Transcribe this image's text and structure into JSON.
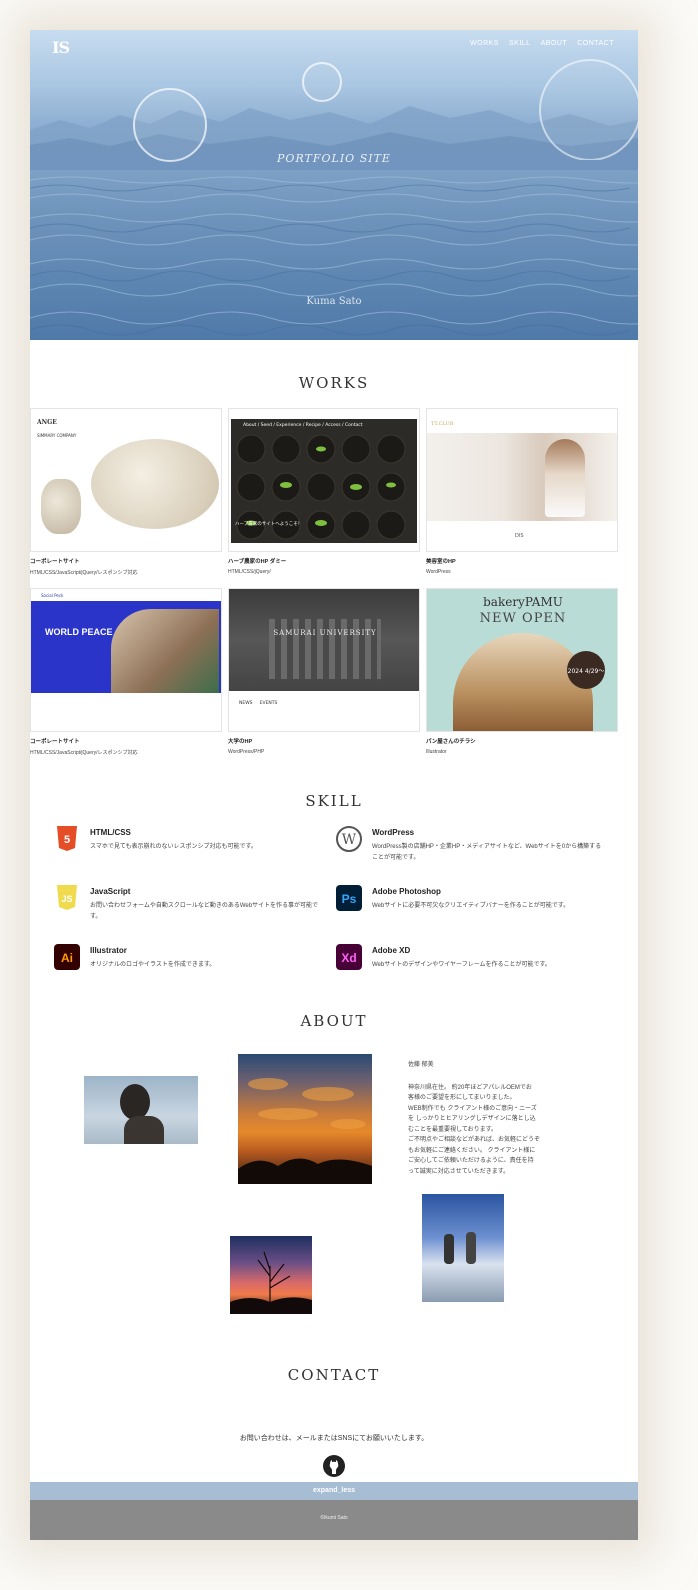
{
  "header": {
    "logo": "IS",
    "nav": [
      "WORKS",
      "SKILL",
      "ABOUT",
      "CONTACT"
    ],
    "hero_title": "PORTFOLIO SITE",
    "hero_sub": "Kuma Sato"
  },
  "works": {
    "title": "WORKS",
    "items": [
      {
        "title": "コーポレートサイト",
        "tech": "HTML/CSS/JavaScript/jQuery/レスポンシブ対応",
        "thumb_text": "ANGE",
        "thumb_sub": "SIMMARY COMPANY"
      },
      {
        "title": "ハーブ農家のHP ダミー",
        "tech": "HTML/CSS/jQuery/",
        "thumb_text": "About / Seed / Experience / Recipe / Access / Contact",
        "thumb_sub": "ハーブ農家のサイトへようこそ！"
      },
      {
        "title": "美容室のHP",
        "tech": "WordPress",
        "thumb_text": "TT.CLUB",
        "thumb_sub": "DIS"
      },
      {
        "title": "コーポレートサイト",
        "tech": "HTML/CSS/JavaScript/jQuery/レスポンシブ対応",
        "thumb_text": "WORLD PEACE",
        "thumb_sub": "Social Peck"
      },
      {
        "title": "大学のHP",
        "tech": "WordPress/PHP",
        "thumb_text": "SAMURAI UNIVERSITY",
        "thumb_sub": "NEWS     EVENTS"
      },
      {
        "title": "パン屋さんのチラシ",
        "tech": "Illustrator",
        "thumb_text": "bakeryPAMU",
        "thumb_sub": "NEW OPEN",
        "thumb_date": "2024 4/29〜"
      }
    ]
  },
  "skill": {
    "title": "SKILL",
    "items": [
      {
        "name": "HTML/CSS",
        "desc": "スマホで見ても表示崩れのないレスポンシブ対応も可能です。",
        "icon": "html5-icon",
        "badge": "5"
      },
      {
        "name": "WordPress",
        "desc": "WordPress製の店舗HP・企業HP・メディアサイトなど、Webサイトを0から構築することが可能です。",
        "icon": "wordpress-icon",
        "badge": "W"
      },
      {
        "name": "JavaScript",
        "desc": "お問い合わせフォームや自動スクロールなど動きのあるWebサイトを作る事が可能です。",
        "icon": "javascript-icon",
        "badge": "JS"
      },
      {
        "name": "Adobe Photoshop",
        "desc": "Webサイトに必要不可欠なクリエイティブバナーを作ることが可能です。",
        "icon": "photoshop-icon",
        "badge": "Ps"
      },
      {
        "name": "Illustrator",
        "desc": "オリジナルのロゴやイラストを作成できます。",
        "icon": "illustrator-icon",
        "badge": "Ai"
      },
      {
        "name": "Adobe XD",
        "desc": "Webサイトのデザインやワイヤーフレームを作ることが可能です。",
        "icon": "xd-icon",
        "badge": "Xd"
      }
    ]
  },
  "about": {
    "title": "ABOUT",
    "name": "佐藤 郁美",
    "lines": [
      "神奈川県在住。 約20年ほどアパレルOEMでお",
      "客様のご要望を形にしてまいりました。",
      "WEB制作でも クライアント様のご意向・ニーズ",
      "を しっかりとヒアリングしデザインに落とし込",
      "むことを最重要視しております。",
      "ご不明点やご相談などがあれば、お気軽にどうぞ",
      "もお気軽にご連絡ください。 クライアント様に",
      "ご安心してご依頼いただけるように、責任を持",
      "って誠実に対応させていただきます。"
    ]
  },
  "contact": {
    "title": "CONTACT",
    "text": "お問い合わせは、メールまたはSNSにてお願いいたします。",
    "icon": "github-icon",
    "expand_label": "expand_less",
    "footer": "©Ikumi Sato"
  },
  "colors": {
    "expand_bar": "#a6bdd4",
    "footer_bg": "#8a8a8a",
    "html5": "#e44d26",
    "js": "#f0db4f",
    "ps_bg": "#001e36",
    "ps_fg": "#31a8ff",
    "ai_bg": "#330000",
    "ai_fg": "#ff9a00",
    "xd_bg": "#470137",
    "xd_fg": "#ff61f6"
  }
}
